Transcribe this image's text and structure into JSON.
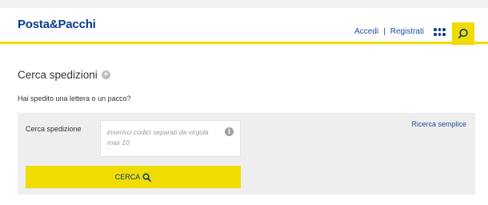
{
  "header": {
    "logo": "Posta&Pacchi",
    "login_label": "Accedi",
    "separator": "|",
    "register_label": "Registrati"
  },
  "main": {
    "title": "Cerca spedizioni",
    "subtitle": "Hai spedito una lettera o un pacco?",
    "form": {
      "field_label": "Cerca spedizione",
      "placeholder": "inserisci codici separati da virgola max 10",
      "simple_search_link": "Ricerca semplice",
      "submit_label": "CERCA"
    }
  },
  "colors": {
    "brand_blue": "#0a3c8c",
    "accent_yellow": "#f0dc00"
  },
  "icons": {
    "header_search": "search-icon",
    "apps": "grid-dots-icon",
    "title_expand": "plus-circle-icon",
    "info": "info-icon"
  }
}
